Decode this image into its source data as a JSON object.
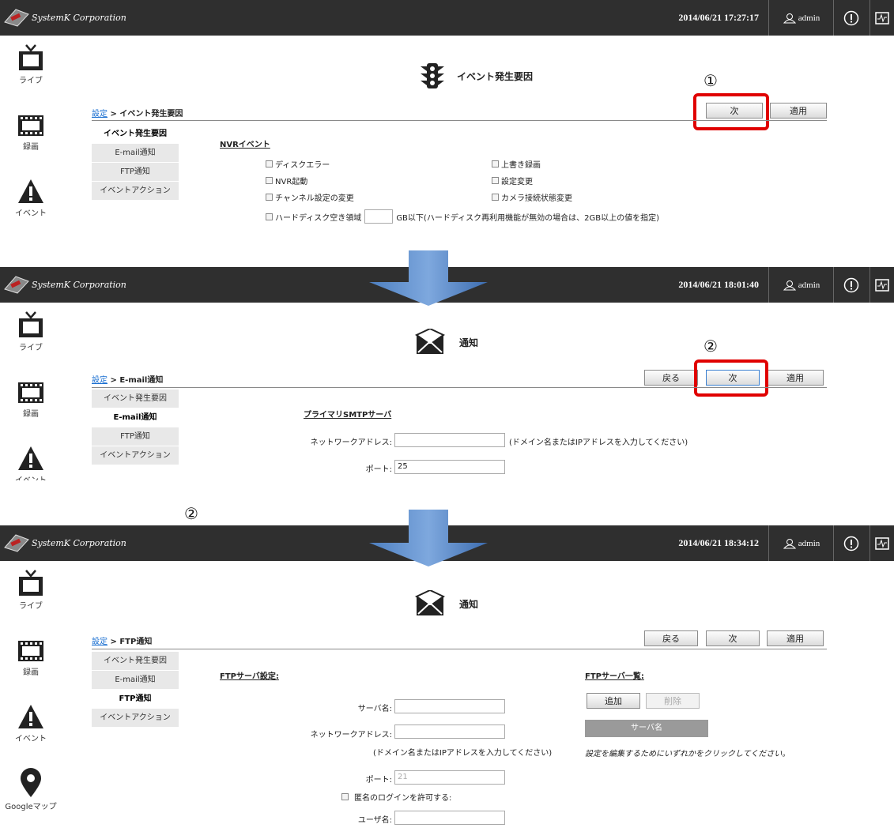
{
  "brand": "SystemK Corporation",
  "user": "admin",
  "nav": {
    "live": "ライブ",
    "record": "録画",
    "event": "イベント",
    "map": "Googleマップ"
  },
  "screens": [
    {
      "datetime": "2014/06/21 17:27:17",
      "section_title": "イベント発生要因",
      "breadcrumb_link": "設定",
      "breadcrumb_current": "> イベント発生要因",
      "marker": "①",
      "buttons": {
        "next": "次",
        "apply": "適用"
      },
      "subnav": [
        "イベント発生要因",
        "E-mail通知",
        "FTP通知",
        "イベントアクション"
      ],
      "content_head": "NVRイベント",
      "checkboxes_left": [
        "ディスクエラー",
        "NVR起動",
        "チャンネル設定の変更"
      ],
      "checkboxes_right": [
        "上書き録画",
        "設定変更",
        "カメラ接続状態変更"
      ],
      "partial_row": "ハードディスク空き領域",
      "partial_row_tail": "GB以下(ハードディスク再利用機能が無効の場合は、2GB以上の値を指定)"
    },
    {
      "datetime": "2014/06/21 18:01:40",
      "section_title": "通知",
      "breadcrumb_link": "設定",
      "breadcrumb_current": "> E-mail通知",
      "marker": "②",
      "buttons": {
        "back": "戻る",
        "next": "次",
        "apply": "適用"
      },
      "subnav": [
        "イベント発生要因",
        "E-mail通知",
        "FTP通知",
        "イベントアクション"
      ],
      "content_head": "プライマリSMTPサーバ",
      "address_label": "ネットワークアドレス:",
      "address_hint": "(ドメイン名またはIPアドレスを入力してください)",
      "port_label": "ポート:",
      "port_value": "25"
    },
    {
      "datetime": "2014/06/21 18:34:12",
      "section_title": "通知",
      "breadcrumb_link": "設定",
      "breadcrumb_current": "> FTP通知",
      "marker": "②",
      "buttons": {
        "back": "戻る",
        "next": "次",
        "apply": "適用"
      },
      "subnav": [
        "イベント発生要因",
        "E-mail通知",
        "FTP通知",
        "イベントアクション"
      ],
      "content_head": "FTPサーバ設定:",
      "server_name_label": "サーバ名:",
      "address_label": "ネットワークアドレス:",
      "address_hint": "(ドメイン名またはIPアドレスを入力してください)",
      "port_label": "ポート:",
      "port_value": "21",
      "anon_label": "匿名のログインを許可する:",
      "user_label": "ユーザ名:",
      "list_head": "FTPサーバ一覧:",
      "add_button": "追加",
      "delete_button": "削除",
      "list_column": "サーバ名",
      "list_hint": "設定を編集するためにいずれかをクリックしてください。"
    }
  ]
}
